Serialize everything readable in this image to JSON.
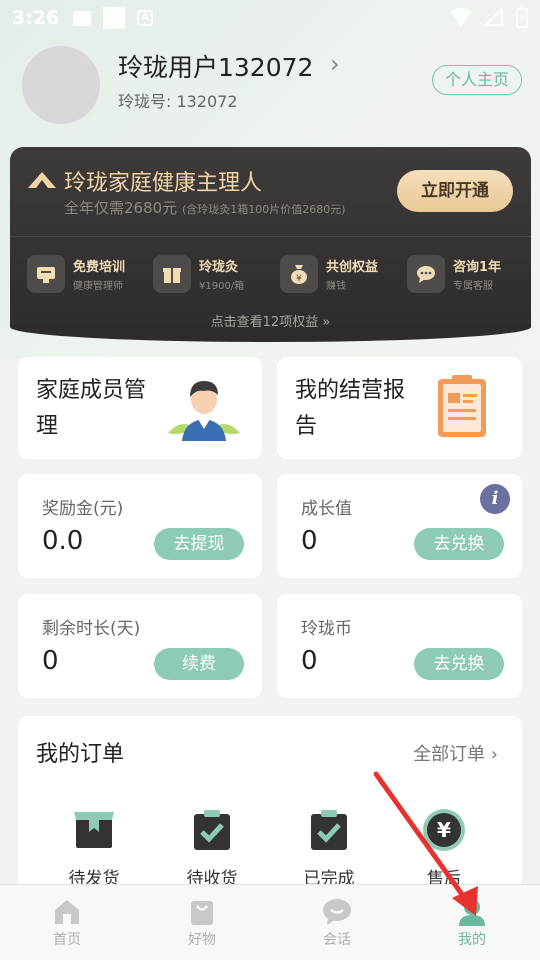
{
  "status_bar": {
    "time": "3:26",
    "a_label": "A"
  },
  "profile": {
    "name": "玲珑用户132072",
    "id_text": "玲珑号: 132072",
    "homepage_button": "个人主页",
    "chevron": "›"
  },
  "vip": {
    "title": "玲珑家庭健康主理人",
    "price_text": "全年仅需2680元",
    "price_note": "(含玲珑灸1箱100片价值2680元)",
    "open_button": "立即开通",
    "benefits": [
      {
        "title": "免费培训",
        "desc": "健康管理师",
        "icon": "training-icon"
      },
      {
        "title": "玲珑灸",
        "desc": "¥1900/箱",
        "icon": "gift-icon"
      },
      {
        "title": "共创权益",
        "desc": "赚钱",
        "icon": "money-bag-icon"
      },
      {
        "title": "咨询1年",
        "desc": "专属客服",
        "icon": "chat-icon"
      }
    ],
    "more_text": "点击查看12项权益 »"
  },
  "features": {
    "family": {
      "label": "家庭成员管理",
      "icon": "family-avatar-icon"
    },
    "report": {
      "label": "我的结营报告",
      "icon": "report-icon"
    }
  },
  "stats": {
    "bonus": {
      "label": "奖励金(元)",
      "value": "0.0",
      "button": "去提现"
    },
    "growth": {
      "label": "成长值",
      "value": "0",
      "button": "去兑换"
    },
    "remaining": {
      "label": "剩余时长(天)",
      "value": "0",
      "button": "续费"
    },
    "coins": {
      "label": "玲珑币",
      "value": "0",
      "button": "去兑换"
    }
  },
  "orders": {
    "title": "我的订单",
    "all_link": "全部订单 ›",
    "items": [
      {
        "label": "待发货",
        "icon": "box-icon"
      },
      {
        "label": "待收货",
        "icon": "clipboard-check-icon"
      },
      {
        "label": "已完成",
        "icon": "clipboard-check-icon"
      },
      {
        "label": "售后",
        "icon": "yen-icon"
      }
    ]
  },
  "nav": {
    "items": [
      {
        "label": "首页",
        "icon": "home-icon"
      },
      {
        "label": "好物",
        "icon": "shopping-bag-icon"
      },
      {
        "label": "会话",
        "icon": "chat-bubble-icon"
      },
      {
        "label": "我的",
        "icon": "profile-icon"
      }
    ],
    "active_index": 3
  },
  "colors": {
    "accent": "#6ab99d",
    "pill": "#8dcbb5",
    "vip_bg": "#35322f",
    "vip_gold": "#f0d4a8",
    "annotation_arrow": "#e8322f"
  }
}
